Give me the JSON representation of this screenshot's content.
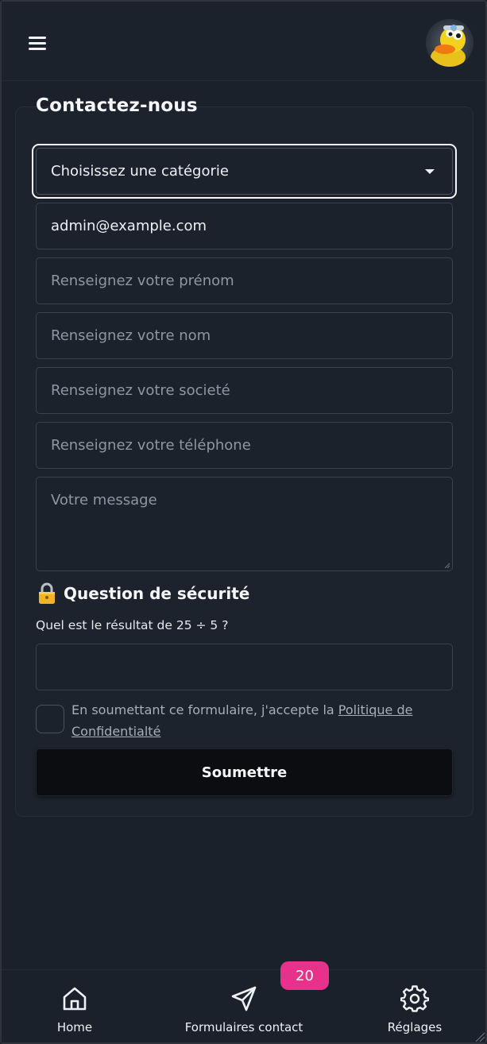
{
  "header": {
    "menu_icon": "hamburger-menu-icon",
    "avatar": "duck-avatar"
  },
  "form": {
    "title": "Contactez-nous",
    "category_select": {
      "selected": "Choisissez une catégorie"
    },
    "email": {
      "value": "admin@example.com"
    },
    "first_name": {
      "placeholder": "Renseignez votre prénom"
    },
    "last_name": {
      "placeholder": "Renseignez votre nom"
    },
    "company": {
      "placeholder": "Renseignez votre societé"
    },
    "phone": {
      "placeholder": "Renseignez votre téléphone"
    },
    "message": {
      "placeholder": "Votre message"
    },
    "security": {
      "title": "Question de sécurité",
      "icon": "lock-icon",
      "question": "Quel est le résultat de 25 ÷ 5 ?",
      "answer": ""
    },
    "consent": {
      "text": "En soumettant ce formulaire, j'accepte la ",
      "link_text": "Politique de Confidentialté",
      "checked": false
    },
    "submit_label": "Soumettre"
  },
  "bottom_nav": {
    "items": [
      {
        "label": "Home",
        "icon": "home-icon"
      },
      {
        "label": "Formulaires contact",
        "icon": "send-icon",
        "badge": "20"
      },
      {
        "label": "Réglages",
        "icon": "gear-icon"
      }
    ]
  },
  "colors": {
    "background": "#1b212b",
    "badge": "#e8318a",
    "submit": "#0c0d10"
  }
}
